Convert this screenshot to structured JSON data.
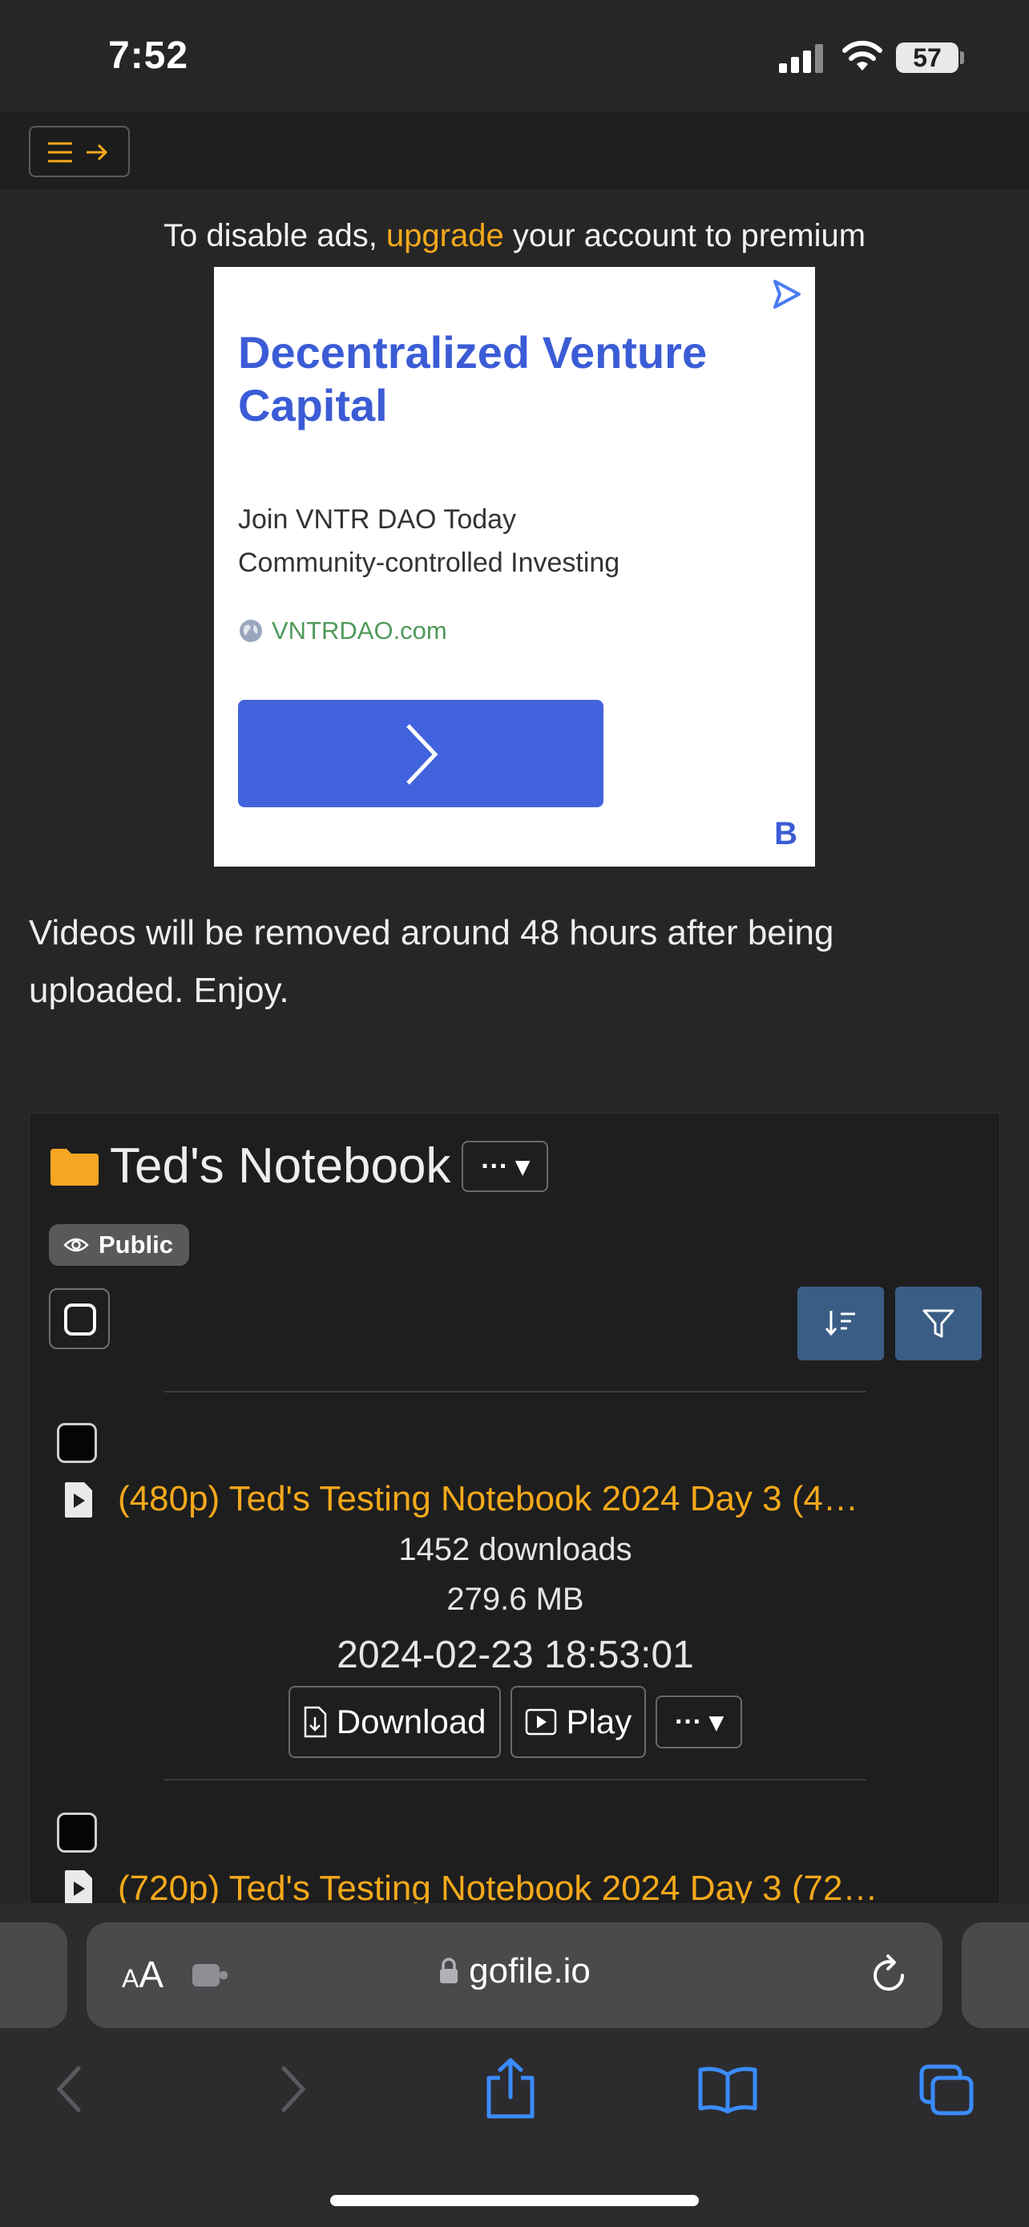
{
  "status_bar": {
    "time": "7:52",
    "battery": "57"
  },
  "nav": {
    "menu_icon": "menu-arrow-icon"
  },
  "ad_notice": {
    "before": "To disable ads, ",
    "link": "upgrade",
    "after": " your account to premium"
  },
  "ad": {
    "title": "Decentralized Venture Capital",
    "line1": "Join VNTR DAO Today",
    "line2": "Community-controlled Investing",
    "url": "VNTRDAO.com",
    "logo_letter": "B"
  },
  "notice": "Videos will be removed around 48 hours after being uploaded. Enjoy.",
  "folder": {
    "name": "Ted's Notebook",
    "menu_label": "··· ▾",
    "badge": "Public"
  },
  "files": [
    {
      "title": "(480p) Ted's Testing Notebook 2024 Day 3 (4…",
      "downloads": "1452 downloads",
      "size": "279.6 MB",
      "date": "2024-02-23 18:53:01",
      "download_label": "Download",
      "play_label": "Play",
      "more_label": "··· ▾"
    },
    {
      "title": "(720p) Ted's Testing Notebook 2024 Day 3 (72…"
    }
  ],
  "browser": {
    "aa_small": "A",
    "aa_large": "A",
    "url": "gofile.io"
  },
  "colors": {
    "accent": "#f4a91b",
    "ad_blue": "#3b5cd6",
    "button_blue": "#3a5d85",
    "background": "#262626"
  }
}
